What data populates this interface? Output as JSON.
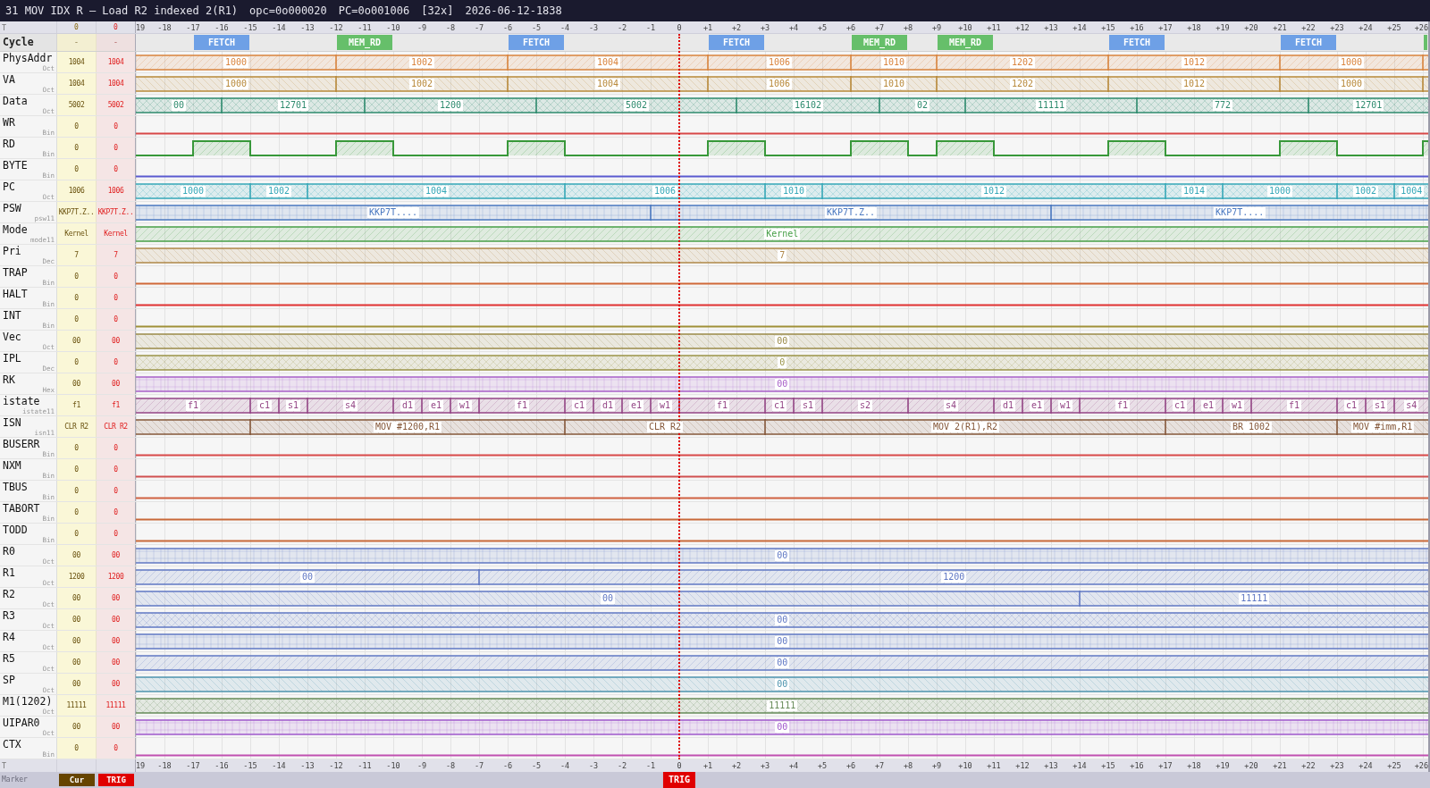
{
  "title_bar": {
    "title": "31 MOV IDX R — Load R2 indexed 2(R1)",
    "opcode": "opc=0o000020",
    "program_counter": "PC=0o001006",
    "zoom": "[32x]",
    "timestamp": "2026-06-12-1838"
  },
  "top_ruler": {
    "label": "T",
    "cursor_time": "0",
    "trigger_time": "0",
    "ticks": [
      "19",
      "-18",
      "-17",
      "-16",
      "-15",
      "-14",
      "-13",
      "-12",
      "-11",
      "-10",
      "-9",
      "-8",
      "-7",
      "-6",
      "-5",
      "-4",
      "-3",
      "-2",
      "-1",
      "0",
      "+1",
      "+2",
      "+3",
      "+4",
      "+5",
      "+6",
      "+7",
      "+8",
      "+9",
      "+10",
      "+11",
      "+12",
      "+13",
      "+14",
      "+15",
      "+16",
      "+17",
      "+18",
      "+19",
      "+20",
      "+21",
      "+22",
      "+23",
      "+24",
      "+25",
      "+26"
    ]
  },
  "signals": [
    {
      "name": "Cycle",
      "kind": "cycle",
      "cursor_value": "-",
      "trigger_value": "-",
      "segments": [
        {
          "label": "FETCH",
          "color": "#6ea0e6"
        },
        {
          "label": "MEM_RD",
          "color": "#66bf6a"
        },
        {
          "label": "FETCH",
          "color": "#6ea0e6"
        },
        {
          "label": "FETCH",
          "color": "#6ea0e6"
        },
        {
          "label": "MEM_RD",
          "color": "#66bf6a"
        },
        {
          "label": "MEM_RD",
          "color": "#66bf6a"
        },
        {
          "label": "FETCH",
          "color": "#6ea0e6"
        },
        {
          "label": "FETCH",
          "color": "#6ea0e6"
        },
        {
          "color": "#66bf6a"
        }
      ]
    },
    {
      "name": "PhysAddr",
      "kind": "bus",
      "radix": "Oct",
      "cursor_value": "1004",
      "trigger_value": "1004",
      "segments": [
        {
          "label": "1000"
        },
        {
          "label": "1002"
        },
        {
          "label": "1004"
        },
        {
          "label": "1006"
        },
        {
          "label": "1010"
        },
        {
          "label": "1202"
        },
        {
          "label": "1012"
        },
        {
          "label": "1000"
        }
      ]
    },
    {
      "name": "VA",
      "kind": "bus",
      "radix": "Oct",
      "cursor_value": "1004",
      "trigger_value": "1004",
      "segments": [
        {
          "label": "1000"
        },
        {
          "label": "1002"
        },
        {
          "label": "1004"
        },
        {
          "label": "1006"
        },
        {
          "label": "1010"
        },
        {
          "label": "1202"
        },
        {
          "label": "1012"
        },
        {
          "label": "1000"
        }
      ]
    },
    {
      "name": "Data",
      "kind": "bus",
      "radix": "Oct",
      "cursor_value": "5002",
      "trigger_value": "5002",
      "segments": [
        {
          "label": "00"
        },
        {
          "label": "12701"
        },
        {
          "label": "1200"
        },
        {
          "label": "5002"
        },
        {
          "label": "16102"
        },
        {
          "label": "02"
        },
        {
          "label": "11111"
        },
        {
          "label": "772"
        },
        {
          "label": "12701"
        }
      ]
    },
    {
      "name": "WR",
      "kind": "bit",
      "radix": "Bin",
      "cursor_value": "0",
      "trigger_value": "0",
      "segments": [
        {
          "high": false
        }
      ]
    },
    {
      "name": "RD",
      "kind": "bit",
      "radix": "Bin",
      "cursor_value": "0",
      "trigger_value": "0",
      "segments": [
        {
          "high": false
        },
        {
          "high": true
        },
        {
          "high": false
        },
        {
          "high": true
        },
        {
          "high": false
        },
        {
          "high": true
        },
        {
          "high": false
        },
        {
          "high": true
        },
        {
          "high": false
        },
        {
          "high": true
        },
        {
          "high": false
        },
        {
          "high": true
        },
        {
          "high": false
        },
        {
          "high": true
        },
        {
          "high": false
        },
        {
          "high": true
        },
        {
          "high": false
        },
        {
          "high": true
        }
      ]
    },
    {
      "name": "BYTE",
      "kind": "bit",
      "radix": "Bin",
      "cursor_value": "0",
      "trigger_value": "0",
      "segments": [
        {
          "high": false
        }
      ]
    },
    {
      "name": "PC",
      "kind": "bus",
      "radix": "Oct",
      "cursor_value": "1006",
      "trigger_value": "1006",
      "segments": [
        {
          "label": "1000"
        },
        {
          "label": "1002"
        },
        {
          "label": "1004"
        },
        {
          "label": "1006"
        },
        {
          "label": "1010"
        },
        {
          "label": "1012"
        },
        {
          "label": "1014"
        },
        {
          "label": "1000"
        },
        {
          "label": "1002"
        },
        {
          "label": "1004"
        }
      ]
    },
    {
      "name": "PSW",
      "kind": "bus",
      "radix": "psw11",
      "cursor_value": "KKP7T.Z..",
      "trigger_value": "KKP7T.Z..",
      "segments": [
        {
          "label": "KKP7T...."
        },
        {
          "label": "KKP7T.Z.."
        },
        {
          "label": "KKP7T...."
        }
      ]
    },
    {
      "name": "Mode",
      "kind": "bus",
      "radix": "mode11",
      "cursor_value": "Kernel",
      "trigger_value": "Kernel",
      "segments": [
        {
          "label": "Kernel"
        }
      ]
    },
    {
      "name": "Pri",
      "kind": "bus",
      "radix": "Dec",
      "cursor_value": "7",
      "trigger_value": "7",
      "segments": [
        {
          "label": "7"
        }
      ]
    },
    {
      "name": "TRAP",
      "kind": "bit",
      "radix": "Bin",
      "cursor_value": "0",
      "trigger_value": "0",
      "segments": [
        {
          "high": false
        }
      ]
    },
    {
      "name": "HALT",
      "kind": "bit",
      "radix": "Bin",
      "cursor_value": "0",
      "trigger_value": "0",
      "segments": [
        {
          "high": false
        }
      ]
    },
    {
      "name": "INT",
      "kind": "bit",
      "radix": "Bin",
      "cursor_value": "0",
      "trigger_value": "0",
      "segments": [
        {
          "high": false
        }
      ]
    },
    {
      "name": "Vec",
      "kind": "bus",
      "radix": "Oct",
      "cursor_value": "00",
      "trigger_value": "00",
      "segments": [
        {
          "label": "00"
        }
      ]
    },
    {
      "name": "IPL",
      "kind": "bus",
      "radix": "Dec",
      "cursor_value": "0",
      "trigger_value": "0",
      "segments": [
        {
          "label": "0"
        }
      ]
    },
    {
      "name": "RK",
      "kind": "bus",
      "radix": "Hex",
      "cursor_value": "00",
      "trigger_value": "00",
      "segments": [
        {
          "label": "00"
        }
      ]
    },
    {
      "name": "istate",
      "kind": "bus",
      "radix": "istate11",
      "cursor_value": "f1",
      "trigger_value": "f1",
      "segments": [
        {
          "label": "f1"
        },
        {
          "label": "c1"
        },
        {
          "label": "s1"
        },
        {
          "label": "s4"
        },
        {
          "label": "d1"
        },
        {
          "label": "e1"
        },
        {
          "label": "w1"
        },
        {
          "label": "f1"
        },
        {
          "label": "c1"
        },
        {
          "label": "d1"
        },
        {
          "label": "e1"
        },
        {
          "label": "w1"
        },
        {
          "label": "f1"
        },
        {
          "label": "c1"
        },
        {
          "label": "s1"
        },
        {
          "label": "s2"
        },
        {
          "label": "s4"
        },
        {
          "label": "d1"
        },
        {
          "label": "e1"
        },
        {
          "label": "w1"
        },
        {
          "label": "f1"
        },
        {
          "label": "c1"
        },
        {
          "label": "e1"
        },
        {
          "label": "w1"
        },
        {
          "label": "f1"
        },
        {
          "label": "c1"
        },
        {
          "label": "s1"
        },
        {
          "label": "s4"
        }
      ]
    },
    {
      "name": "ISN",
      "kind": "bus",
      "radix": "isn11",
      "cursor_value": "CLR R2",
      "trigger_value": "CLR R2",
      "segments": [
        {
          "label": "MOV #1200,R1"
        },
        {
          "label": "CLR R2"
        },
        {
          "label": "MOV 2(R1),R2"
        },
        {
          "label": "BR 1002"
        },
        {
          "label": "MOV #imm,R1"
        }
      ]
    },
    {
      "name": "BUSERR",
      "kind": "bit",
      "radix": "Bin",
      "cursor_value": "0",
      "trigger_value": "0",
      "segments": [
        {
          "high": false
        }
      ]
    },
    {
      "name": "NXM",
      "kind": "bit",
      "radix": "Bin",
      "cursor_value": "0",
      "trigger_value": "0",
      "segments": [
        {
          "high": false
        }
      ]
    },
    {
      "name": "TBUS",
      "kind": "bit",
      "radix": "Bin",
      "cursor_value": "0",
      "trigger_value": "0",
      "segments": [
        {
          "high": false
        }
      ]
    },
    {
      "name": "TABORT",
      "kind": "bit",
      "radix": "Bin",
      "cursor_value": "0",
      "trigger_value": "0",
      "segments": [
        {
          "high": false
        }
      ]
    },
    {
      "name": "TODD",
      "kind": "bit",
      "radix": "Bin",
      "cursor_value": "0",
      "trigger_value": "0",
      "segments": [
        {
          "high": false
        }
      ]
    },
    {
      "name": "R0",
      "kind": "bus",
      "radix": "Oct",
      "cursor_value": "00",
      "trigger_value": "00",
      "segments": [
        {
          "label": "00"
        }
      ]
    },
    {
      "name": "R1",
      "kind": "bus",
      "radix": "Oct",
      "cursor_value": "1200",
      "trigger_value": "1200",
      "segments": [
        {
          "label": "00"
        },
        {
          "label": "1200"
        }
      ]
    },
    {
      "name": "R2",
      "kind": "bus",
      "radix": "Oct",
      "cursor_value": "00",
      "trigger_value": "00",
      "segments": [
        {
          "label": "00"
        },
        {
          "label": "11111"
        }
      ]
    },
    {
      "name": "R3",
      "kind": "bus",
      "radix": "Oct",
      "cursor_value": "00",
      "trigger_value": "00",
      "segments": [
        {
          "label": "00"
        }
      ]
    },
    {
      "name": "R4",
      "kind": "bus",
      "radix": "Oct",
      "cursor_value": "00",
      "trigger_value": "00",
      "segments": [
        {
          "label": "00"
        }
      ]
    },
    {
      "name": "R5",
      "kind": "bus",
      "radix": "Oct",
      "cursor_value": "00",
      "trigger_value": "00",
      "segments": [
        {
          "label": "00"
        }
      ]
    },
    {
      "name": "SP",
      "kind": "bus",
      "radix": "Oct",
      "cursor_value": "00",
      "trigger_value": "00",
      "segments": [
        {
          "label": "00"
        }
      ]
    },
    {
      "name": "M1(1202)",
      "kind": "bus",
      "radix": "Oct",
      "cursor_value": "11111",
      "trigger_value": "11111",
      "segments": [
        {
          "label": "11111"
        }
      ]
    },
    {
      "name": "UIPAR0",
      "kind": "bus",
      "radix": "Oct",
      "cursor_value": "00",
      "trigger_value": "00",
      "segments": [
        {
          "label": "00"
        }
      ]
    },
    {
      "name": "CTX",
      "kind": "bit",
      "radix": "Bin",
      "cursor_value": "0",
      "trigger_value": "0",
      "segments": [
        {
          "high": false
        }
      ]
    }
  ],
  "bottom_ruler": {
    "label": "T",
    "ticks": [
      "19",
      "-18",
      "-17",
      "-16",
      "-15",
      "-14",
      "-13",
      "-12",
      "-11",
      "-10",
      "-9",
      "-8",
      "-7",
      "-6",
      "-5",
      "-4",
      "-3",
      "-2",
      "-1",
      "0",
      "+1",
      "+2",
      "+3",
      "+4",
      "+5",
      "+6",
      "+7",
      "+8",
      "+9",
      "+10",
      "+11",
      "+12",
      "+13",
      "+14",
      "+15",
      "+16",
      "+17",
      "+18",
      "+19",
      "+20",
      "+21",
      "+22",
      "+23",
      "+24",
      "+25",
      "+26"
    ]
  },
  "marker_bar": {
    "label": "Marker",
    "buttons": [
      {
        "label": "Cur",
        "kind": "cursor"
      },
      {
        "label": "TRIG",
        "kind": "trigger"
      }
    ],
    "trigger_marker": "TRIG"
  }
}
